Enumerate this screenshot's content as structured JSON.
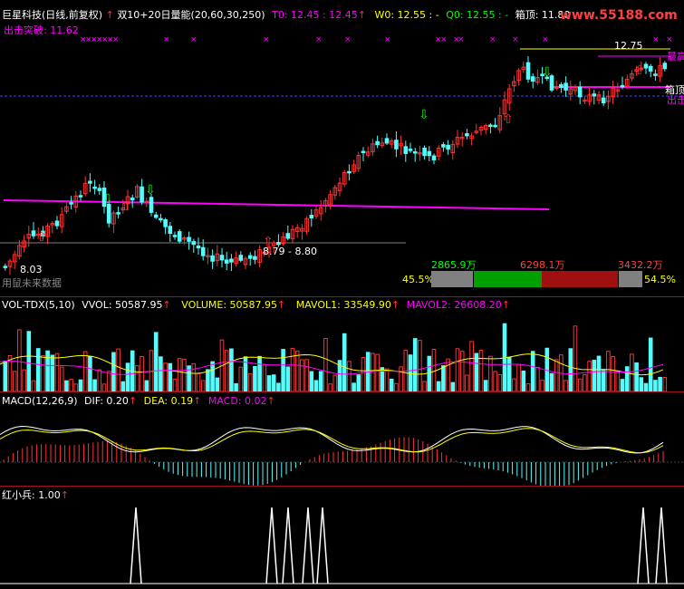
{
  "colors": {
    "up": "#ff3232",
    "down": "#54fcfc",
    "magenta": "#ff00ff",
    "yellow": "#ffff00",
    "white": "#ffffff",
    "green": "#00c000",
    "gray": "#808080",
    "divider": "#a0141e"
  },
  "main": {
    "stock": "巨星科技(日线,前复权)",
    "indicator": "双10+20日量能(20,60,30,250)",
    "t0": "T0: 12.45",
    "w0": "W0: 12.55",
    "q0": "Q0: 12.55",
    "zhenzhi": "箱顶: 11.80",
    "chuji": "出击突破: 11.62",
    "watermark": "www.55188.com",
    "price_label": "8.79 - 8.80",
    "low_label": "8.03",
    "high_label": "12.75",
    "future_label": "用鼠未来数据",
    "right_label1": "最高",
    "right_label2": "箱顶",
    "right_label3": "出击",
    "bar_values": [
      "2865.9万",
      "6298.1万",
      "3432.2万"
    ],
    "pct_left": "45.5%",
    "pct_right": "54.5%"
  },
  "vol": {
    "name": "VOL-TDX(5,10)",
    "vvol": "VVOL: 50587.95",
    "volume": "VOLUME: 50587.95",
    "mavol1": "MAVOL1: 33549.90",
    "mavol2": "MAVOL2: 26608.20"
  },
  "macd": {
    "name": "MACD(12,26,9)",
    "dif": "DIF: 0.20",
    "dea": "DEA: 0.19",
    "macd": "MACD: 0.02"
  },
  "red_soldier": {
    "name": "红小兵",
    "value": ": 1.00"
  }
}
